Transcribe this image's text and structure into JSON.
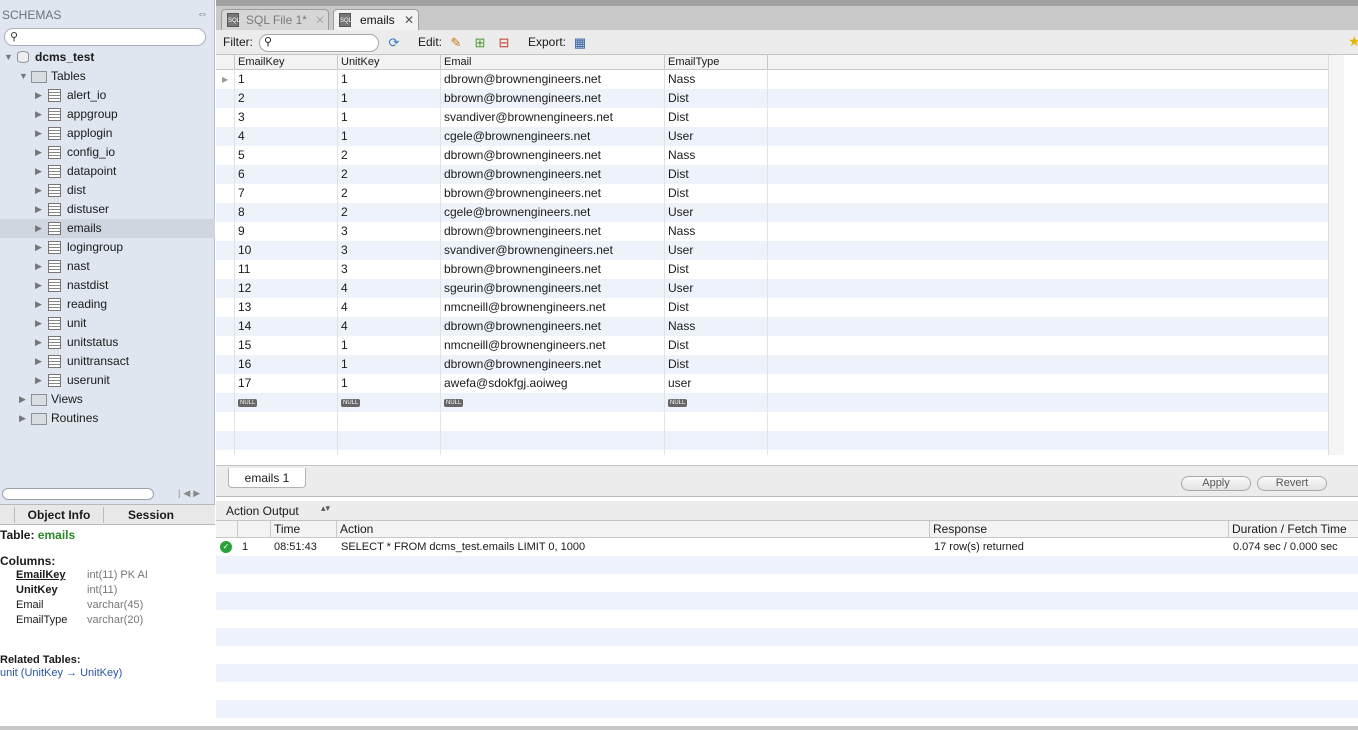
{
  "sidebar": {
    "title": "SCHEMAS",
    "schema": "dcms_test",
    "tables_label": "Tables",
    "tables": [
      "alert_io",
      "appgroup",
      "applogin",
      "config_io",
      "datapoint",
      "dist",
      "distuser",
      "emails",
      "logingroup",
      "nast",
      "nastdist",
      "reading",
      "unit",
      "unitstatus",
      "unittransact",
      "userunit"
    ],
    "selected_table": "emails",
    "views_label": "Views",
    "routines_label": "Routines"
  },
  "info": {
    "tabs": [
      "Object Info",
      "Session"
    ],
    "table_prefix": "Table:",
    "table_name": "emails",
    "columns_label": "Columns:",
    "columns": [
      {
        "name": "EmailKey",
        "type": "int(11) PK AI"
      },
      {
        "name": "UnitKey",
        "type": "int(11)"
      },
      {
        "name": "Email",
        "type": "varchar(45)"
      },
      {
        "name": "EmailType",
        "type": "varchar(20)"
      }
    ],
    "related_label": "Related Tables:",
    "related": "unit (UnitKey → UnitKey)"
  },
  "tabs": [
    {
      "label": "SQL File 1*"
    },
    {
      "label": "emails"
    }
  ],
  "toolbar": {
    "filter": "Filter:",
    "edit": "Edit:",
    "export": "Export:"
  },
  "grid": {
    "columns": [
      "EmailKey",
      "UnitKey",
      "Email",
      "EmailType"
    ],
    "rows": [
      [
        "1",
        "1",
        "dbrown@brownengineers.net",
        "Nass"
      ],
      [
        "2",
        "1",
        "bbrown@brownengineers.net",
        "Dist"
      ],
      [
        "3",
        "1",
        "svandiver@brownengineers.net",
        "Dist"
      ],
      [
        "4",
        "1",
        "cgele@brownengineers.net",
        "User"
      ],
      [
        "5",
        "2",
        "dbrown@brownengineers.net",
        "Nass"
      ],
      [
        "6",
        "2",
        "dbrown@brownengineers.net",
        "Dist"
      ],
      [
        "7",
        "2",
        "bbrown@brownengineers.net",
        "Dist"
      ],
      [
        "8",
        "2",
        "cgele@brownengineers.net",
        "User"
      ],
      [
        "9",
        "3",
        "dbrown@brownengineers.net",
        "Nass"
      ],
      [
        "10",
        "3",
        "svandiver@brownengineers.net",
        "User"
      ],
      [
        "11",
        "3",
        "bbrown@brownengineers.net",
        "Dist"
      ],
      [
        "12",
        "4",
        "sgeurin@brownengineers.net",
        "User"
      ],
      [
        "13",
        "4",
        "nmcneill@brownengineers.net",
        "Dist"
      ],
      [
        "14",
        "4",
        "dbrown@brownengineers.net",
        "Nass"
      ],
      [
        "15",
        "1",
        "nmcneill@brownengineers.net",
        "Dist"
      ],
      [
        "16",
        "1",
        "dbrown@brownengineers.net",
        "Dist"
      ],
      [
        "17",
        "1",
        "awefa@sdokfgj.aoiweg",
        "user"
      ]
    ],
    "null_label": "NULL"
  },
  "results": {
    "tab": "emails 1",
    "apply": "Apply",
    "revert": "Revert"
  },
  "output": {
    "selector": "Action Output",
    "columns": [
      "",
      "Time",
      "Action",
      "Response",
      "Duration / Fetch Time"
    ],
    "rows": [
      {
        "num": "1",
        "time": "08:51:43",
        "action": "SELECT * FROM dcms_test.emails LIMIT 0, 1000",
        "response": "17 row(s) returned",
        "duration": "0.074 sec / 0.000 sec"
      }
    ]
  }
}
